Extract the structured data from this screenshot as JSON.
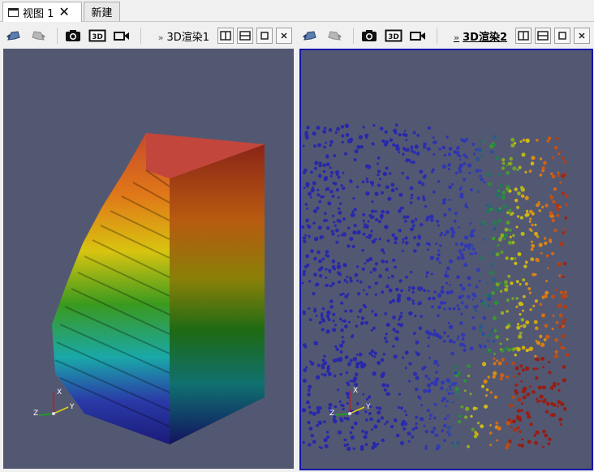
{
  "tabs": [
    {
      "label": "视图 1",
      "active": true
    },
    {
      "label": "新建",
      "active": false
    }
  ],
  "left_view": {
    "label": "3D渲染1",
    "active": false
  },
  "right_view": {
    "label": "3D渲染2",
    "active": true
  },
  "toolbar_icons": [
    "undo-camera-icon",
    "redo-camera-icon",
    "camera-capture-icon",
    "3d-toggle-icon",
    "record-icon"
  ],
  "window_buttons": [
    "split-horizontal-icon",
    "split-vertical-icon",
    "maximize-icon",
    "close-icon"
  ],
  "axes": {
    "x": "X",
    "y": "Y",
    "z": "Z"
  },
  "colors": {
    "background": "#535872",
    "active_border": "#1414aa",
    "colormap": [
      "#1a1a80",
      "#3b4cc0",
      "#00ced1",
      "#2e8b2e",
      "#e0e000",
      "#ff8c00",
      "#c0392b"
    ]
  }
}
